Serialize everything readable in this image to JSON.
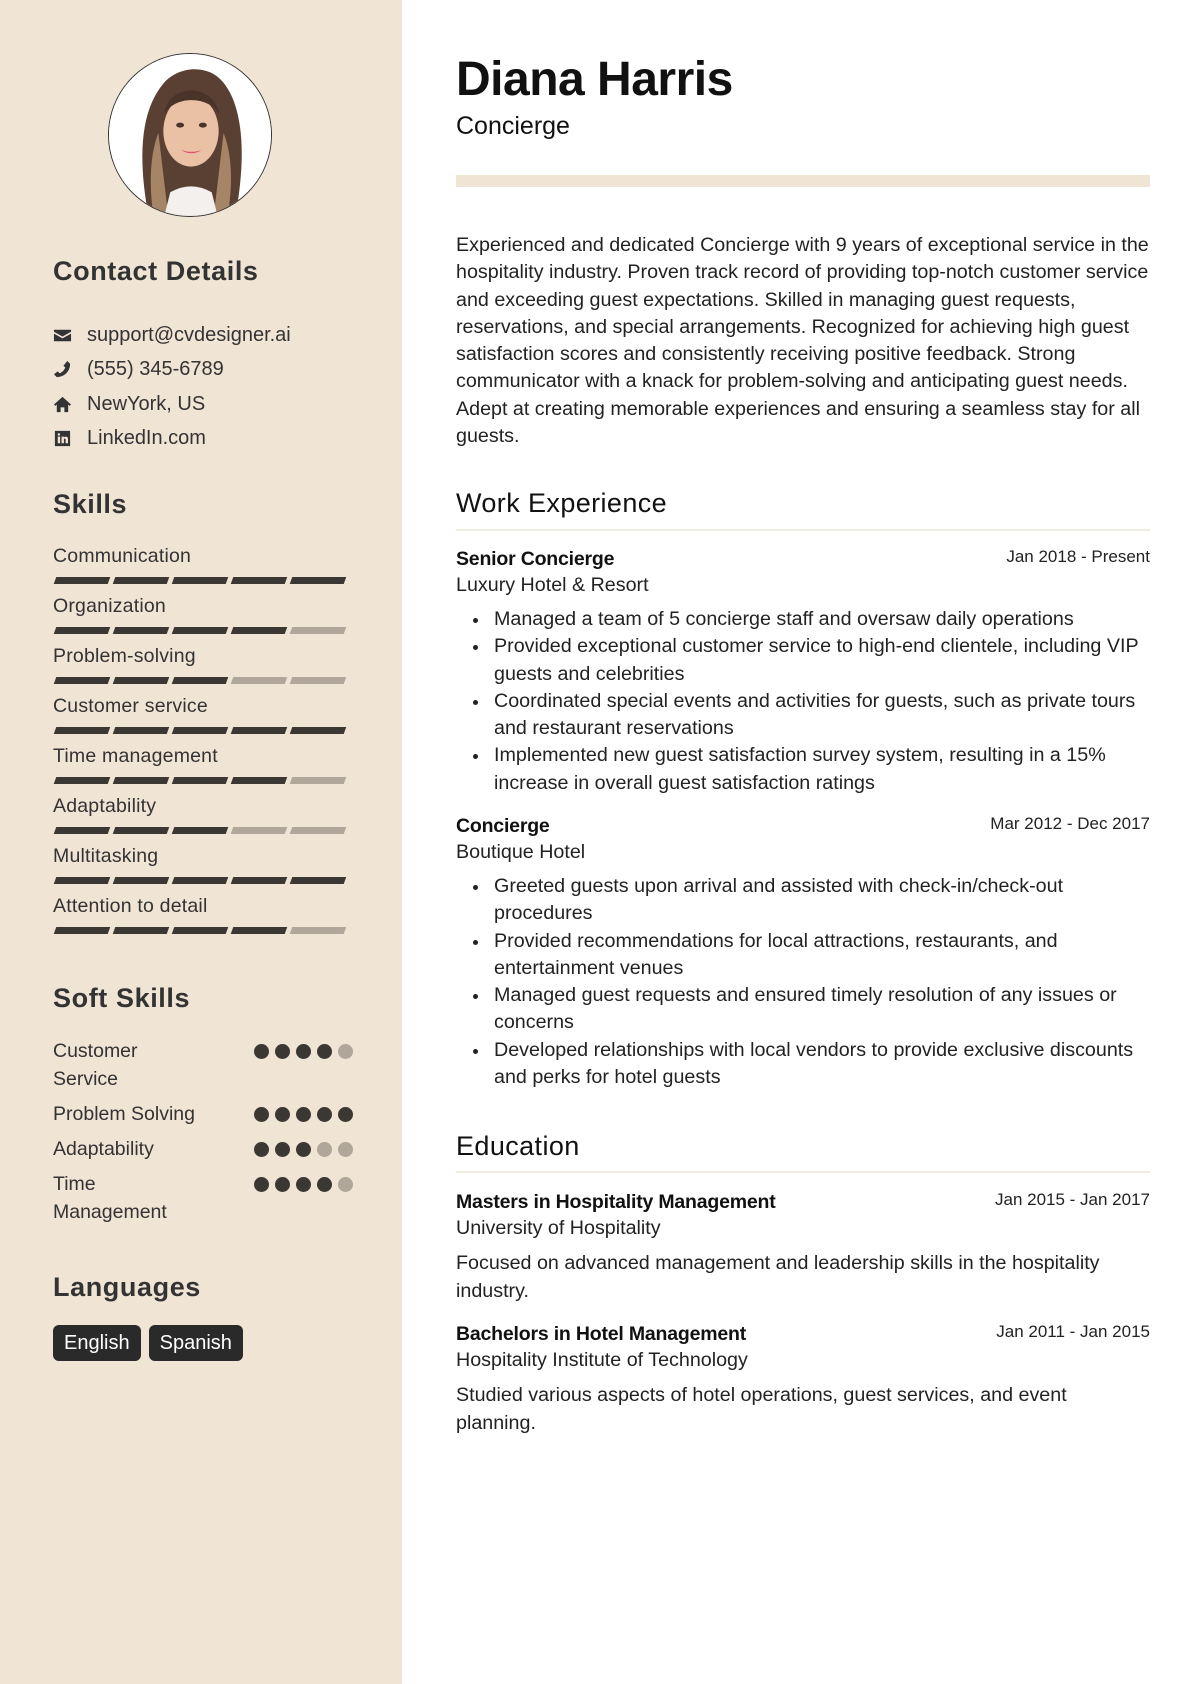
{
  "profile": {
    "name": "Diana Harris",
    "role": "Concierge",
    "photo_icon": "profile-photo",
    "summary": "Experienced and dedicated Concierge with 9 years of exceptional service in the hospitality industry. Proven track record of providing top-notch customer service and exceeding guest expectations. Skilled in managing guest requests, reservations, and special arrangements. Recognized for achieving high guest satisfaction scores and consistently receiving positive feedback. Strong communicator with a knack for problem-solving and anticipating guest needs. Adept at creating memorable experiences and ensuring a seamless stay for all guests."
  },
  "colors": {
    "sidebar_bg": "#f0e4d5",
    "rating_filled": "#3b3833",
    "rating_empty": "#b0a69a",
    "pill_bg": "#2a2a2a"
  },
  "contact": {
    "heading": "Contact Details",
    "items": [
      {
        "icon": "envelope-icon",
        "text": "support@cvdesigner.ai"
      },
      {
        "icon": "phone-icon",
        "text": "(555) 345-6789"
      },
      {
        "icon": "home-icon",
        "text": "NewYork, US"
      },
      {
        "icon": "linkedin-icon",
        "text": "LinkedIn.com"
      }
    ]
  },
  "skills": {
    "heading": "Skills",
    "max": 5,
    "items": [
      {
        "name": "Communication",
        "level": 5
      },
      {
        "name": "Organization",
        "level": 4
      },
      {
        "name": "Problem-solving",
        "level": 3
      },
      {
        "name": "Customer service",
        "level": 5
      },
      {
        "name": "Time management",
        "level": 4
      },
      {
        "name": "Adaptability",
        "level": 3
      },
      {
        "name": "Multitasking",
        "level": 5
      },
      {
        "name": "Attention to detail",
        "level": 4
      }
    ]
  },
  "soft_skills": {
    "heading": "Soft Skills",
    "max": 5,
    "items": [
      {
        "name": "Customer Service",
        "level": 4
      },
      {
        "name": "Problem Solving",
        "level": 5
      },
      {
        "name": "Adaptability",
        "level": 3
      },
      {
        "name": "Time Management",
        "level": 4
      }
    ]
  },
  "languages": {
    "heading": "Languages",
    "items": [
      "English",
      "Spanish"
    ]
  },
  "work": {
    "heading": "Work Experience",
    "entries": [
      {
        "title": "Senior Concierge",
        "company": "Luxury Hotel & Resort",
        "dates": "Jan 2018 - Present",
        "bullets": [
          "Managed a team of 5 concierge staff and oversaw daily operations",
          "Provided exceptional customer service to high-end clientele, including VIP guests and celebrities",
          "Coordinated special events and activities for guests, such as private tours and restaurant reservations",
          "Implemented new guest satisfaction survey system, resulting in a 15% increase in overall guest satisfaction ratings"
        ]
      },
      {
        "title": "Concierge",
        "company": "Boutique Hotel",
        "dates": "Mar 2012 - Dec 2017",
        "bullets": [
          "Greeted guests upon arrival and assisted with check-in/check-out procedures",
          "Provided recommendations for local attractions, restaurants, and entertainment venues",
          "Managed guest requests and ensured timely resolution of any issues or concerns",
          "Developed relationships with local vendors to provide exclusive discounts and perks for hotel guests"
        ]
      }
    ]
  },
  "education": {
    "heading": "Education",
    "entries": [
      {
        "degree": "Masters in Hospitality Management",
        "school": "University of Hospitality",
        "dates": "Jan 2015 - Jan 2017",
        "description": "Focused on advanced management and leadership skills in the hospitality industry."
      },
      {
        "degree": "Bachelors in Hotel Management",
        "school": "Hospitality Institute of Technology",
        "dates": "Jan 2011 - Jan 2015",
        "description": "Studied various aspects of hotel operations, guest services, and event planning."
      }
    ]
  }
}
